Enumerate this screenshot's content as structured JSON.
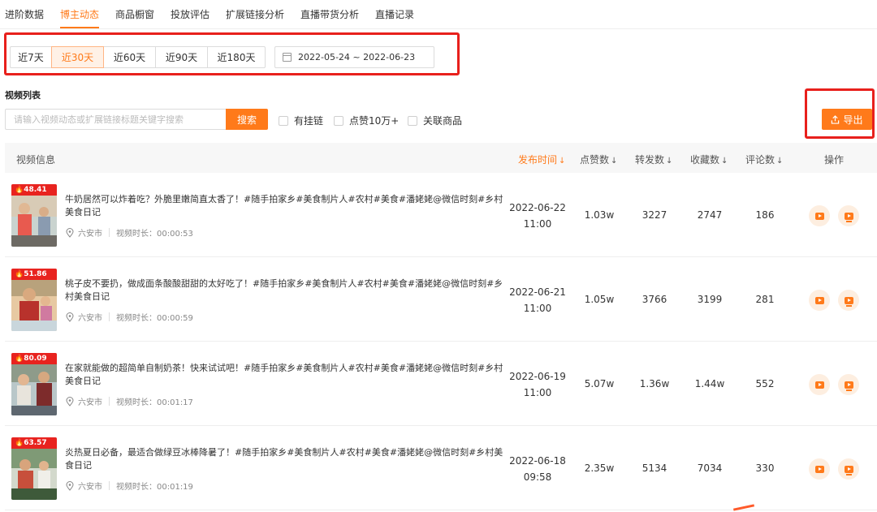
{
  "tabs": [
    {
      "label": "进阶数据"
    },
    {
      "label": "博主动态",
      "active": true
    },
    {
      "label": "商品橱窗"
    },
    {
      "label": "投放评估"
    },
    {
      "label": "扩展链接分析"
    },
    {
      "label": "直播带货分析"
    },
    {
      "label": "直播记录"
    }
  ],
  "range": {
    "options": [
      "近7天",
      "近30天",
      "近60天",
      "近90天",
      "近180天"
    ],
    "selected": "近30天",
    "date_text": "2022-05-24  ~  2022-06-23"
  },
  "list_title": "视频列表",
  "search": {
    "placeholder": "请输入视频动态或扩展链接标题关键字搜索",
    "button": "搜索"
  },
  "filters": [
    "有挂链",
    "点赞10万+",
    "关联商品"
  ],
  "export_label": "导出",
  "columns": {
    "info": "视频信息",
    "pubtime": "发布时间",
    "likes": "点赞数",
    "shares": "转发数",
    "favorites": "收藏数",
    "comments": "评论数",
    "ops": "操作",
    "sort_arrow": "↓"
  },
  "rows": [
    {
      "score": "48.41",
      "title": "牛奶居然可以炸着吃？外脆里嫩简直太香了！#随手拍家乡#美食制片人#农村#美食#潘姥姥@微信时刻#乡村美食日记",
      "location": "六安市",
      "duration": "视频时长：00:00:53",
      "date": "2022-06-22",
      "time": "11:00",
      "likes": "1.03w",
      "shares": "3227",
      "favorites": "2747",
      "comments": "186"
    },
    {
      "score": "51.86",
      "title": "桃子皮不要扔，做成面条酸酸甜甜的太好吃了！#随手拍家乡#美食制片人#农村#美食#潘姥姥@微信时刻#乡村美食日记",
      "location": "六安市",
      "duration": "视频时长：00:00:59",
      "date": "2022-06-21",
      "time": "11:00",
      "likes": "1.05w",
      "shares": "3766",
      "favorites": "3199",
      "comments": "281"
    },
    {
      "score": "80.09",
      "title": "在家就能做的超简单自制奶茶！快来试试吧！#随手拍家乡#美食制片人#农村#美食#潘姥姥@微信时刻#乡村美食日记",
      "location": "六安市",
      "duration": "视频时长：00:01:17",
      "date": "2022-06-19",
      "time": "11:00",
      "likes": "5.07w",
      "shares": "1.36w",
      "favorites": "1.44w",
      "comments": "552"
    },
    {
      "score": "63.57",
      "title": "炎热夏日必备，最适合做绿豆冰棒降暑了！#随手拍家乡#美食制片人#农村#美食#潘姥姥@微信时刻#乡村美食日记",
      "location": "六安市",
      "duration": "视频时长：00:01:19",
      "date": "2022-06-18",
      "time": "09:58",
      "likes": "2.35w",
      "shares": "5134",
      "favorites": "7034",
      "comments": "330"
    }
  ],
  "colors": {
    "accent": "#ff7a1a",
    "highlight_border": "#e8201c",
    "badge": "#e8231f"
  }
}
